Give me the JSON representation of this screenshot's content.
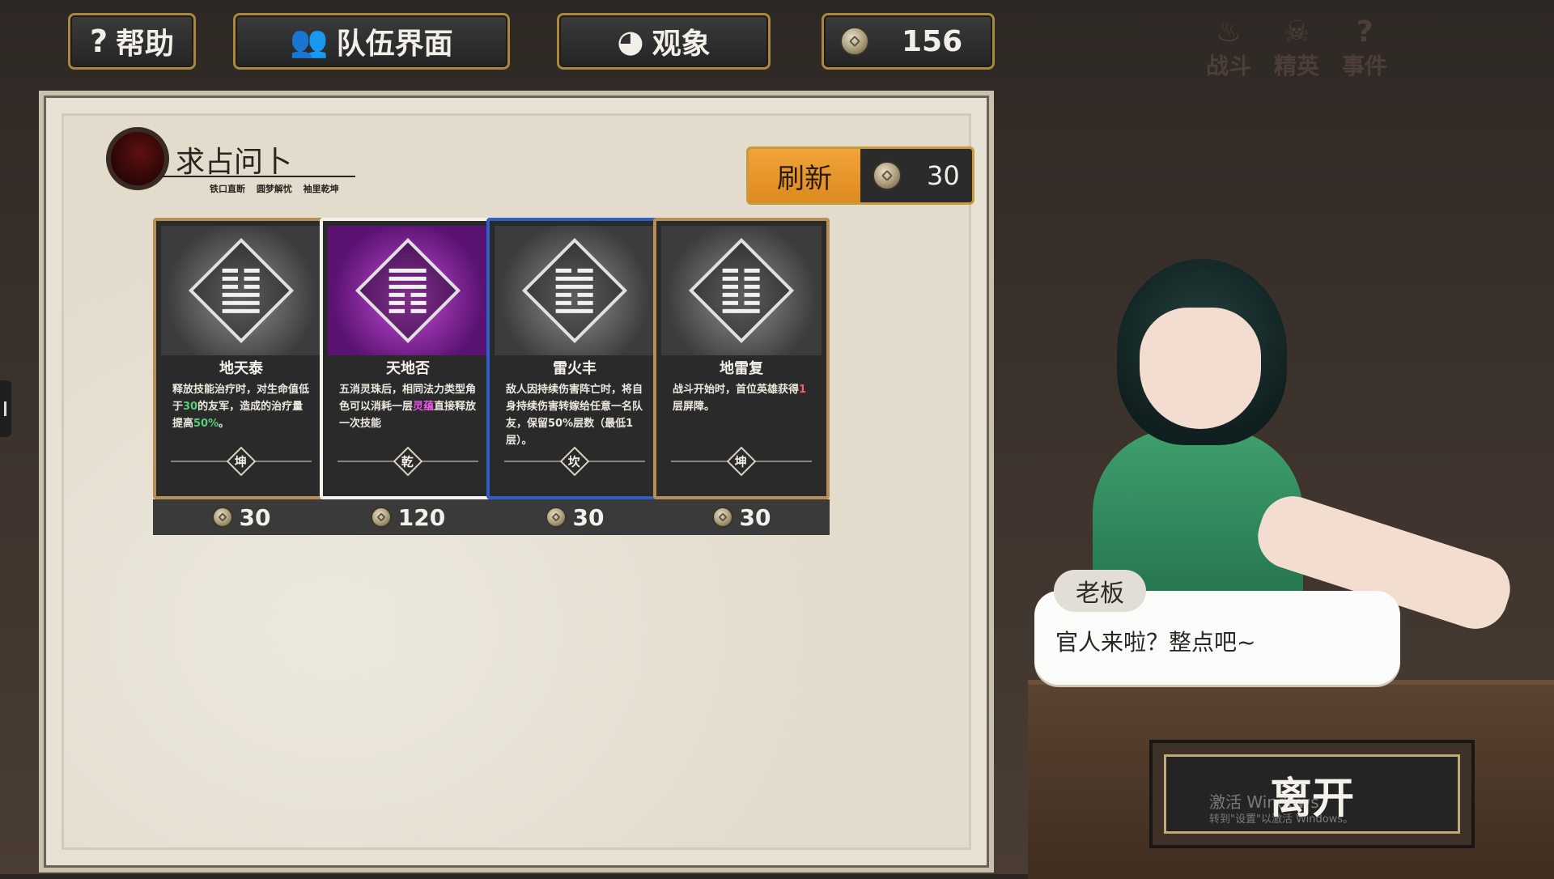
{
  "topbar": {
    "help_label": "帮助",
    "team_label": "队伍界面",
    "observe_label": "观象",
    "currency": "156"
  },
  "bg_nav": [
    "战斗",
    "精英",
    "事件"
  ],
  "panel": {
    "title": "求占问卜",
    "subtitle": "铁口直断 圆梦解忧 袖里乾坤",
    "refresh_label": "刷新",
    "refresh_cost": "30"
  },
  "cards": [
    {
      "name": "地天泰",
      "tag": "坤",
      "price": "30",
      "desc_parts": [
        "释放技能治疗时，对生命值低于",
        "30",
        "的友军，造成的治疗量提高",
        "50%",
        "。"
      ]
    },
    {
      "name": "天地否",
      "tag": "乾",
      "price": "120",
      "desc_parts": [
        "五消灵珠后，相同法力类型角色可以消耗一层",
        "灵蕴",
        "直接释放一次技能"
      ]
    },
    {
      "name": "雷火丰",
      "tag": "坎",
      "price": "30",
      "desc": "敌人因持续伤害阵亡时，将自身持续伤害转嫁给任意一名队友，保留50%层数（最低1层）。"
    },
    {
      "name": "地雷复",
      "tag": "坤",
      "price": "30",
      "desc_parts": [
        "战斗开始时，首位英雄获得",
        "1",
        "层屏障。"
      ]
    }
  ],
  "dialog": {
    "speaker": "老板",
    "text": "官人来啦？整点吧~"
  },
  "leave_label": "离开",
  "watermark": {
    "line1": "激活 Windows",
    "line2": "转到\"设置\"以激活 Windows。"
  }
}
